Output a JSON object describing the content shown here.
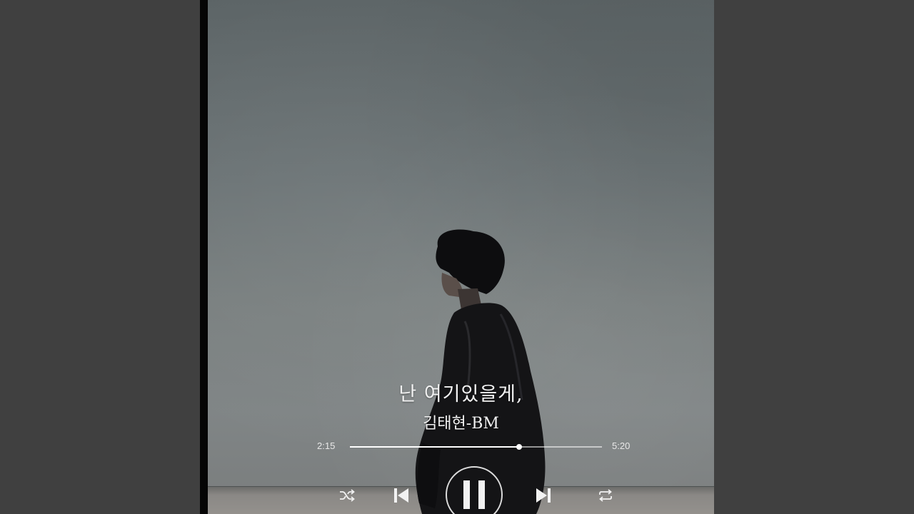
{
  "player": {
    "song_title": "난 여기있을게,",
    "artist": "김태현-BM",
    "elapsed": "2:15",
    "total": "5:20",
    "progress_fraction": 0.67,
    "state": "playing"
  },
  "controls": {
    "shuffle_icon": "shuffle-icon",
    "prev_icon": "skip-previous-icon",
    "play_pause_icon": "pause-icon",
    "next_icon": "skip-next-icon",
    "repeat_icon": "repeat-icon"
  },
  "colors": {
    "background": "#404040",
    "text": "#f2f2f2",
    "accent": "#ffffff"
  }
}
